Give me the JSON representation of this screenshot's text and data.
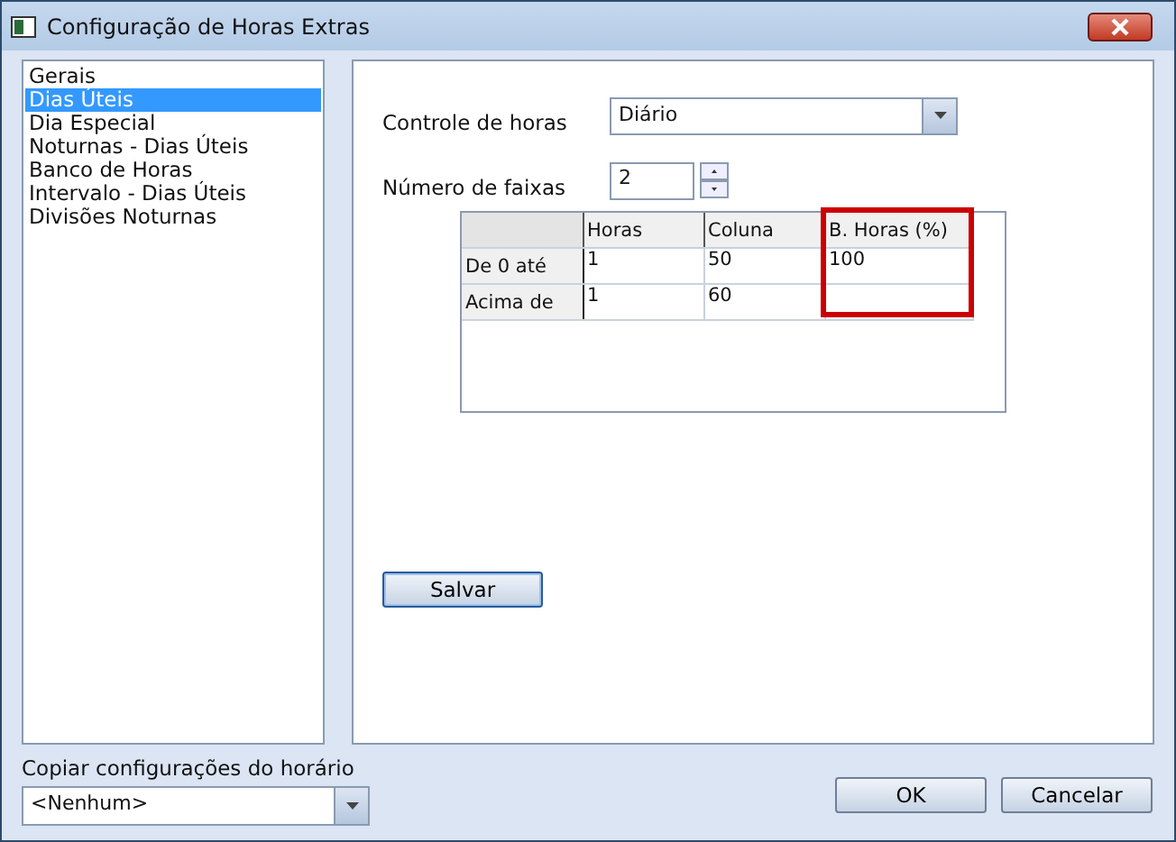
{
  "window": {
    "title": "Configuração de Horas Extras"
  },
  "sidebar": {
    "items": [
      {
        "label": "Gerais",
        "selected": false
      },
      {
        "label": "Dias Úteis",
        "selected": true
      },
      {
        "label": "Dia Especial",
        "selected": false
      },
      {
        "label": "Noturnas - Dias Úteis",
        "selected": false
      },
      {
        "label": "Banco de Horas",
        "selected": false
      },
      {
        "label": "Intervalo - Dias Úteis",
        "selected": false
      },
      {
        "label": "Divisões Noturnas",
        "selected": false
      }
    ]
  },
  "form": {
    "controle_label": "Controle de horas",
    "controle_value": "Diário",
    "faixas_label": "Número de faixas",
    "faixas_value": "2"
  },
  "table": {
    "columns": [
      {
        "highlighted": false
      },
      {
        "label": "Horas",
        "highlighted": false
      },
      {
        "label": "Coluna",
        "highlighted": false
      },
      {
        "label": "B. Horas (%)",
        "highlighted": true
      }
    ],
    "rows": [
      [
        "De 0 até",
        "1",
        "50",
        "100"
      ],
      [
        "Acima de",
        "1",
        "60",
        ""
      ]
    ]
  },
  "save_button": "Salvar",
  "copy": {
    "label": "Copiar configurações do horário",
    "value": "<Nenhum>"
  },
  "buttons": [
    "OK",
    "Cancelar"
  ]
}
